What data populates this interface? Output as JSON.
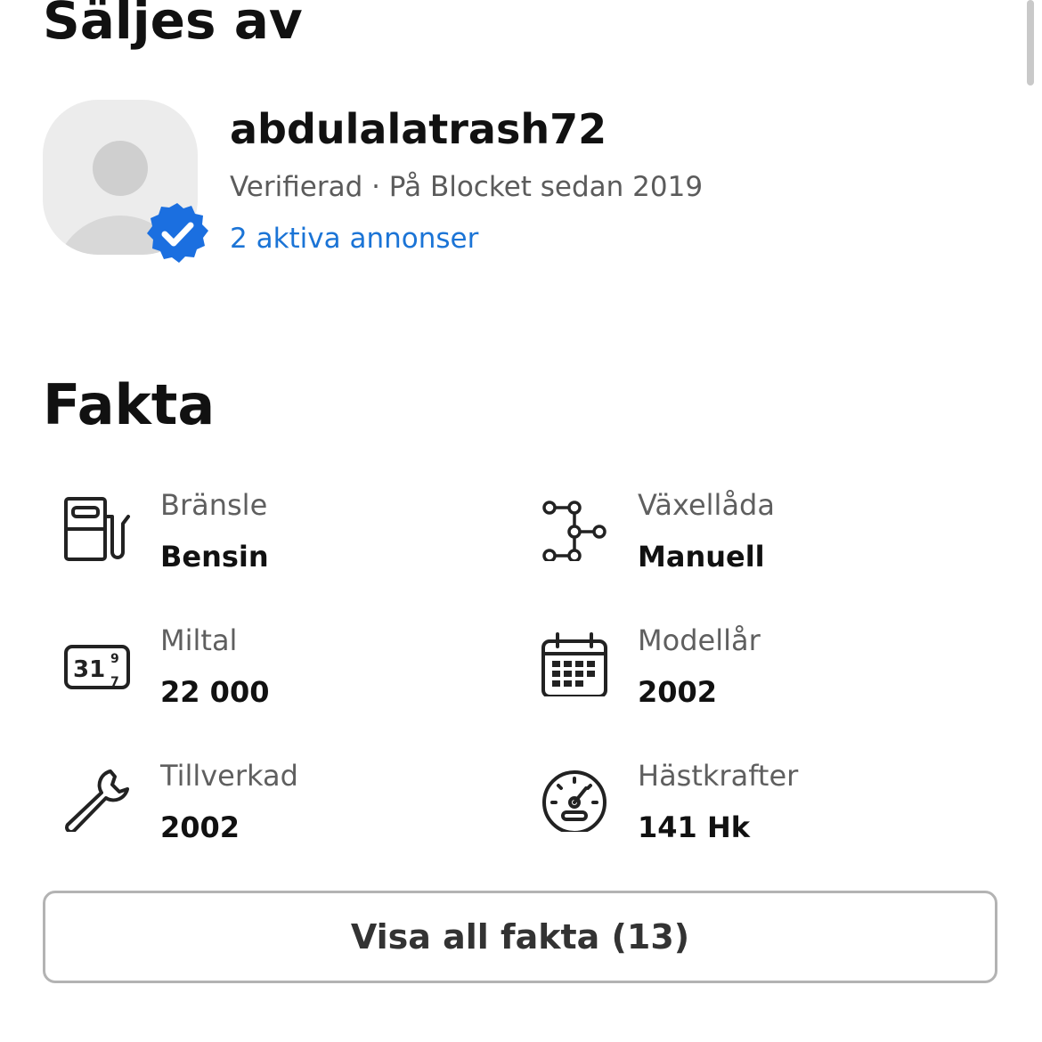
{
  "seller": {
    "section_title": "Säljes av",
    "name": "abdulalatrash72",
    "meta": "Verifierad · På Blocket sedan 2019",
    "active_ads_link": "2 aktiva annonser",
    "avatar_icon": "user-avatar-placeholder",
    "badge_icon": "verified-check-icon",
    "badge_color": "#1b6fe0"
  },
  "facts": {
    "section_title": "Fakta",
    "items": [
      {
        "label": "Bränsle",
        "value": "Bensin",
        "icon": "fuel-pump-icon"
      },
      {
        "label": "Växellåda",
        "value": "Manuell",
        "icon": "gearbox-icon"
      },
      {
        "label": "Miltal",
        "value": "22 000",
        "icon": "odometer-icon"
      },
      {
        "label": "Modellår",
        "value": "2002",
        "icon": "calendar-icon"
      },
      {
        "label": "Tillverkad",
        "value": "2002",
        "icon": "wrench-icon"
      },
      {
        "label": "Hästkrafter",
        "value": "141 Hk",
        "icon": "speedometer-icon"
      }
    ],
    "show_all_button": "Visa all fakta (13)"
  },
  "colors": {
    "link": "#1b74d6",
    "label": "#5f5f5f",
    "text": "#111111"
  }
}
